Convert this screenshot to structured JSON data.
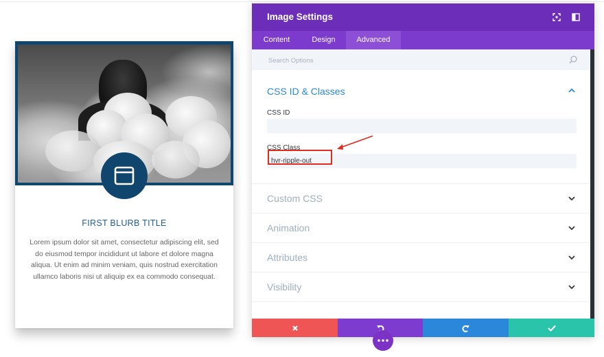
{
  "blurb": {
    "title": "FIRST BLURB TITLE",
    "body": "Lorem ipsum dolor sit amet, consectetur adipiscing elit, sed do eiusmod tempor incididunt ut labore et dolore magna aliqua. Ut enim ad minim veniam, quis nostrud exercitation ullamco laboris nisi ut aliquip ex ea commodo consequat.",
    "icon": "window-icon"
  },
  "modal": {
    "title": "Image Settings",
    "header_icons": [
      "expand-icon",
      "sidebar-toggle-icon"
    ],
    "tabs": [
      {
        "label": "Content",
        "active": false
      },
      {
        "label": "Design",
        "active": false
      },
      {
        "label": "Advanced",
        "active": true
      }
    ],
    "search": {
      "placeholder": "Search Options"
    },
    "open_section": {
      "title": "CSS ID & Classes",
      "fields": [
        {
          "label": "CSS ID",
          "value": ""
        },
        {
          "label": "CSS Class",
          "value": "hvr-ripple-out"
        }
      ]
    },
    "collapsed_sections": [
      "Custom CSS",
      "Animation",
      "Attributes",
      "Visibility"
    ],
    "footer_buttons": [
      "close-icon",
      "undo-icon",
      "redo-icon",
      "check-icon"
    ]
  },
  "colors": {
    "header": "#6c2eb9",
    "tabs": "#7d3bcd",
    "cancel": "#ef5555",
    "undo": "#7e3bd0",
    "redo": "#2b87da",
    "save": "#29c4a9",
    "blurb_accent": "#10456d"
  }
}
